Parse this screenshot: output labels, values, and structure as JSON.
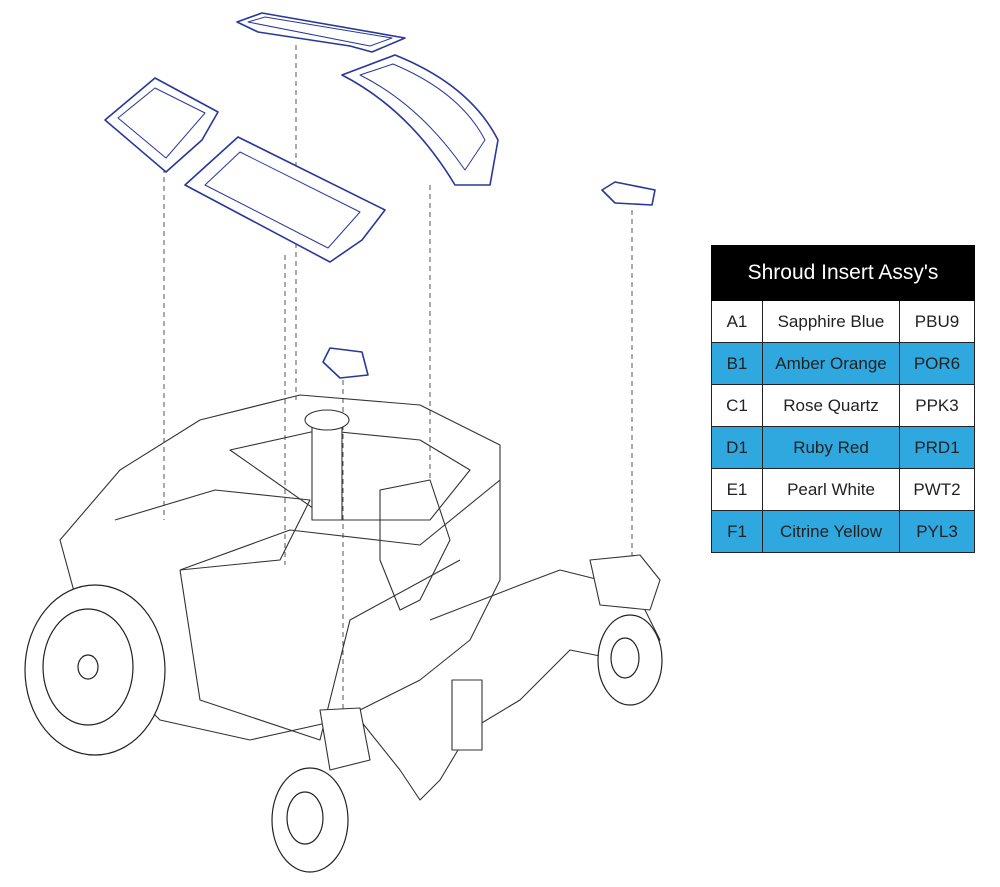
{
  "colors": {
    "panel_stroke": "#27389a",
    "row_highlight": "#2ea8df",
    "header_bg": "#000000"
  },
  "table": {
    "title": "Shroud Insert Assy's",
    "rows": [
      {
        "code": "A1",
        "color": "Sapphire Blue",
        "part": "PBU9",
        "highlight": false
      },
      {
        "code": "B1",
        "color": "Amber Orange",
        "part": "POR6",
        "highlight": true
      },
      {
        "code": "C1",
        "color": "Rose Quartz",
        "part": "PPK3",
        "highlight": false
      },
      {
        "code": "D1",
        "color": "Ruby Red",
        "part": "PRD1",
        "highlight": true
      },
      {
        "code": "E1",
        "color": "Pearl White",
        "part": "PWT2",
        "highlight": false
      },
      {
        "code": "F1",
        "color": "Citrine Yellow",
        "part": "PYL3",
        "highlight": true
      }
    ]
  }
}
